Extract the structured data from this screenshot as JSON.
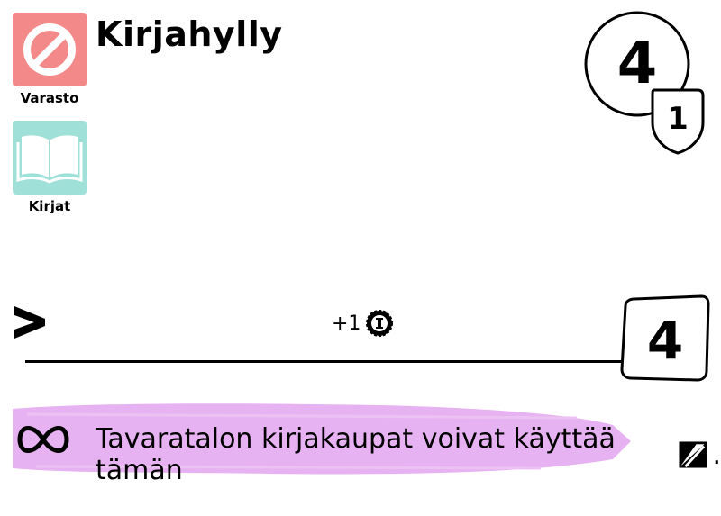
{
  "card": {
    "title": "Kirjahylly",
    "cost": "4",
    "cost_sub": "1",
    "points": "4"
  },
  "tags": [
    {
      "label": "Varasto",
      "icon": "no-entry-icon",
      "color": "#f48989"
    },
    {
      "label": "Kirjat",
      "icon": "open-book-icon",
      "color": "#9fe0d9"
    }
  ],
  "effect": {
    "prefix_icon": "chevron-right-icon",
    "text": "+1",
    "icon": "coin-icon"
  },
  "ability": {
    "icon": "infinity-icon",
    "text": "Tavaratalon kirjakaupat voivat käyttää tämän",
    "resource_icon": "half-filled-square-icon",
    "suffix": ".",
    "band_color": "#e3a4ee"
  }
}
